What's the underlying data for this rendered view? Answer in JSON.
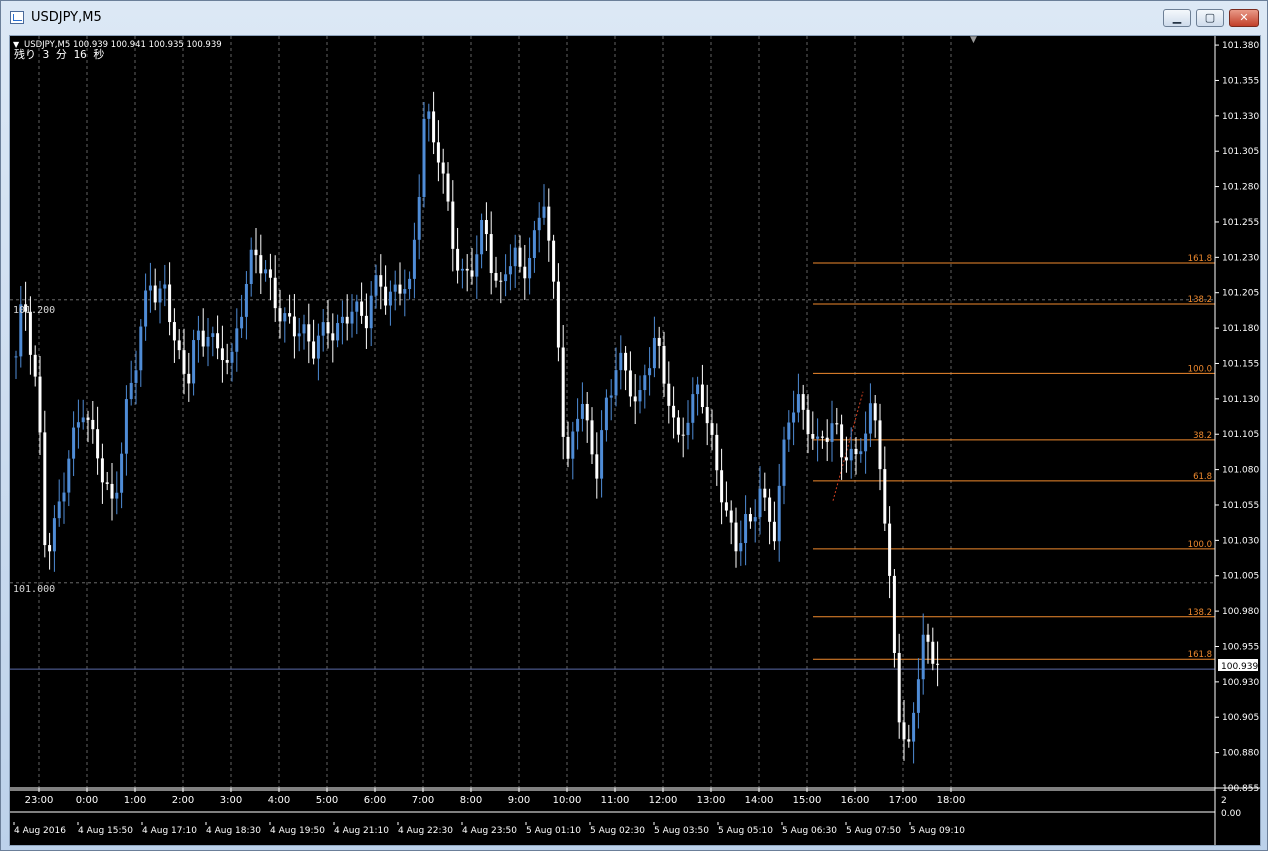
{
  "window": {
    "title": "USDJPY,M5",
    "minimize_icon": "minimize-icon",
    "maximize_icon": "maximize-icon",
    "close_icon": "close-icon"
  },
  "chart": {
    "header_line": "USDJPY,M5  100.939 100.941 100.935 100.939",
    "countdown": "残り 3 分 16 秒",
    "current_price": "100.939",
    "level_labels": [
      "101.200",
      "101.000"
    ],
    "subwindow_scale": [
      "2",
      "0.00"
    ],
    "colors": {
      "background": "#000000",
      "bull_candle": "#4f8cd6",
      "bear_candle": "#ffffff",
      "grid": "#7a7a7a",
      "fibo": "#f08a2e",
      "bid_line": "#5a6aa8"
    }
  },
  "chart_data": {
    "type": "candlestick",
    "symbol": "USDJPY",
    "timeframe": "M5",
    "ylim": [
      100.855,
      101.385
    ],
    "price_ticks": [
      "101.380",
      "101.355",
      "101.330",
      "101.305",
      "101.280",
      "101.255",
      "101.230",
      "101.205",
      "101.180",
      "101.155",
      "101.130",
      "101.105",
      "101.080",
      "101.055",
      "101.030",
      "101.005",
      "100.980",
      "100.955",
      "100.930",
      "100.905",
      "100.880",
      "100.855"
    ],
    "hour_labels": [
      "23:00",
      "0:00",
      "1:00",
      "2:00",
      "3:00",
      "4:00",
      "5:00",
      "6:00",
      "7:00",
      "8:00",
      "9:00",
      "10:00",
      "11:00",
      "12:00",
      "13:00",
      "14:00",
      "15:00",
      "16:00",
      "17:00",
      "18:00"
    ],
    "date_labels": [
      "4 Aug 2016",
      "4 Aug 15:50",
      "4 Aug 17:10",
      "4 Aug 18:30",
      "4 Aug 19:50",
      "4 Aug 21:10",
      "4 Aug 22:30",
      "4 Aug 23:50",
      "5 Aug 01:10",
      "5 Aug 02:30",
      "5 Aug 03:50",
      "5 Aug 05:10",
      "5 Aug 06:30",
      "5 Aug 07:50",
      "5 Aug 09:10"
    ],
    "horizontal_levels": [
      101.2,
      101.0
    ],
    "current_price": 100.939,
    "fibonacci_levels": [
      {
        "label": "161.8",
        "price": 101.226
      },
      {
        "label": "138.2",
        "price": 101.197
      },
      {
        "label": "100.0",
        "price": 101.148
      },
      {
        "label": "38.2",
        "price": 101.101
      },
      {
        "label": "61.8",
        "price": 101.072
      },
      {
        "label": "100.0",
        "price": 101.024
      },
      {
        "label": "138.2",
        "price": 100.976
      },
      {
        "label": "161.8",
        "price": 100.946
      }
    ],
    "price_path": [
      [
        0,
        101.16
      ],
      [
        1,
        101.2
      ],
      [
        3,
        101.12
      ],
      [
        4,
        101.02
      ],
      [
        5,
        101.04
      ],
      [
        7,
        101.09
      ],
      [
        9,
        101.12
      ],
      [
        10,
        101.1
      ],
      [
        11,
        101.09
      ],
      [
        12,
        101.07
      ],
      [
        13,
        101.06
      ],
      [
        14,
        101.09
      ],
      [
        15,
        101.13
      ],
      [
        16,
        101.15
      ],
      [
        17,
        101.18
      ],
      [
        18,
        101.21
      ],
      [
        19,
        101.2
      ],
      [
        20,
        101.21
      ],
      [
        21,
        101.19
      ],
      [
        22,
        101.16
      ],
      [
        23,
        101.14
      ],
      [
        24,
        101.17
      ],
      [
        25,
        101.16
      ],
      [
        26,
        101.18
      ],
      [
        27,
        101.16
      ],
      [
        28,
        101.17
      ],
      [
        29,
        101.16
      ],
      [
        30,
        101.19
      ],
      [
        31,
        101.21
      ],
      [
        32,
        101.23
      ],
      [
        33,
        101.22
      ],
      [
        34,
        101.21
      ],
      [
        35,
        101.2
      ],
      [
        36,
        101.19
      ],
      [
        37,
        101.19
      ],
      [
        38,
        101.18
      ],
      [
        39,
        101.17
      ],
      [
        40,
        101.16
      ],
      [
        41,
        101.17
      ],
      [
        42,
        101.18
      ],
      [
        43,
        101.18
      ],
      [
        44,
        101.19
      ],
      [
        45,
        101.2
      ],
      [
        46,
        101.19
      ],
      [
        47,
        101.18
      ],
      [
        48,
        101.2
      ],
      [
        49,
        101.21
      ],
      [
        50,
        101.2
      ],
      [
        51,
        101.21
      ],
      [
        52,
        101.22
      ],
      [
        53,
        101.21
      ],
      [
        54,
        101.26
      ],
      [
        55,
        101.33
      ],
      [
        56,
        101.31
      ],
      [
        57,
        101.3
      ],
      [
        58,
        101.27
      ],
      [
        59,
        101.24
      ],
      [
        60,
        101.22
      ],
      [
        61,
        101.22
      ],
      [
        62,
        101.23
      ],
      [
        63,
        101.25
      ],
      [
        64,
        101.22
      ],
      [
        65,
        101.2
      ],
      [
        66,
        101.23
      ],
      [
        67,
        101.24
      ],
      [
        68,
        101.22
      ],
      [
        69,
        101.23
      ],
      [
        70,
        101.24
      ],
      [
        71,
        101.27
      ],
      [
        72,
        101.22
      ],
      [
        73,
        101.17
      ],
      [
        74,
        101.08
      ],
      [
        75,
        101.11
      ],
      [
        76,
        101.14
      ],
      [
        77,
        101.1
      ],
      [
        78,
        101.07
      ],
      [
        79,
        101.11
      ],
      [
        80,
        101.13
      ],
      [
        81,
        101.17
      ],
      [
        82,
        101.15
      ],
      [
        83,
        101.14
      ],
      [
        84,
        101.13
      ],
      [
        85,
        101.15
      ],
      [
        86,
        101.17
      ],
      [
        87,
        101.14
      ],
      [
        88,
        101.13
      ],
      [
        89,
        101.1
      ],
      [
        90,
        101.12
      ],
      [
        91,
        101.13
      ],
      [
        92,
        101.14
      ],
      [
        93,
        101.11
      ],
      [
        94,
        101.08
      ],
      [
        95,
        101.06
      ],
      [
        96,
        101.04
      ],
      [
        97,
        101.03
      ],
      [
        98,
        101.05
      ],
      [
        99,
        101.04
      ],
      [
        100,
        101.07
      ],
      [
        101,
        101.04
      ],
      [
        102,
        101.03
      ],
      [
        103,
        101.08
      ],
      [
        104,
        101.12
      ],
      [
        105,
        101.14
      ],
      [
        106,
        101.12
      ],
      [
        107,
        101.11
      ],
      [
        108,
        101.09
      ],
      [
        109,
        101.1
      ],
      [
        110,
        101.11
      ],
      [
        111,
        101.09
      ],
      [
        112,
        101.1
      ],
      [
        113,
        101.09
      ],
      [
        114,
        101.11
      ],
      [
        115,
        101.12
      ],
      [
        116,
        101.1
      ],
      [
        117,
        101.03
      ],
      [
        118,
        100.96
      ],
      [
        119,
        100.9
      ],
      [
        120,
        100.88
      ],
      [
        121,
        100.93
      ],
      [
        122,
        100.96
      ],
      [
        123,
        100.95
      ],
      [
        124,
        100.939
      ]
    ]
  }
}
